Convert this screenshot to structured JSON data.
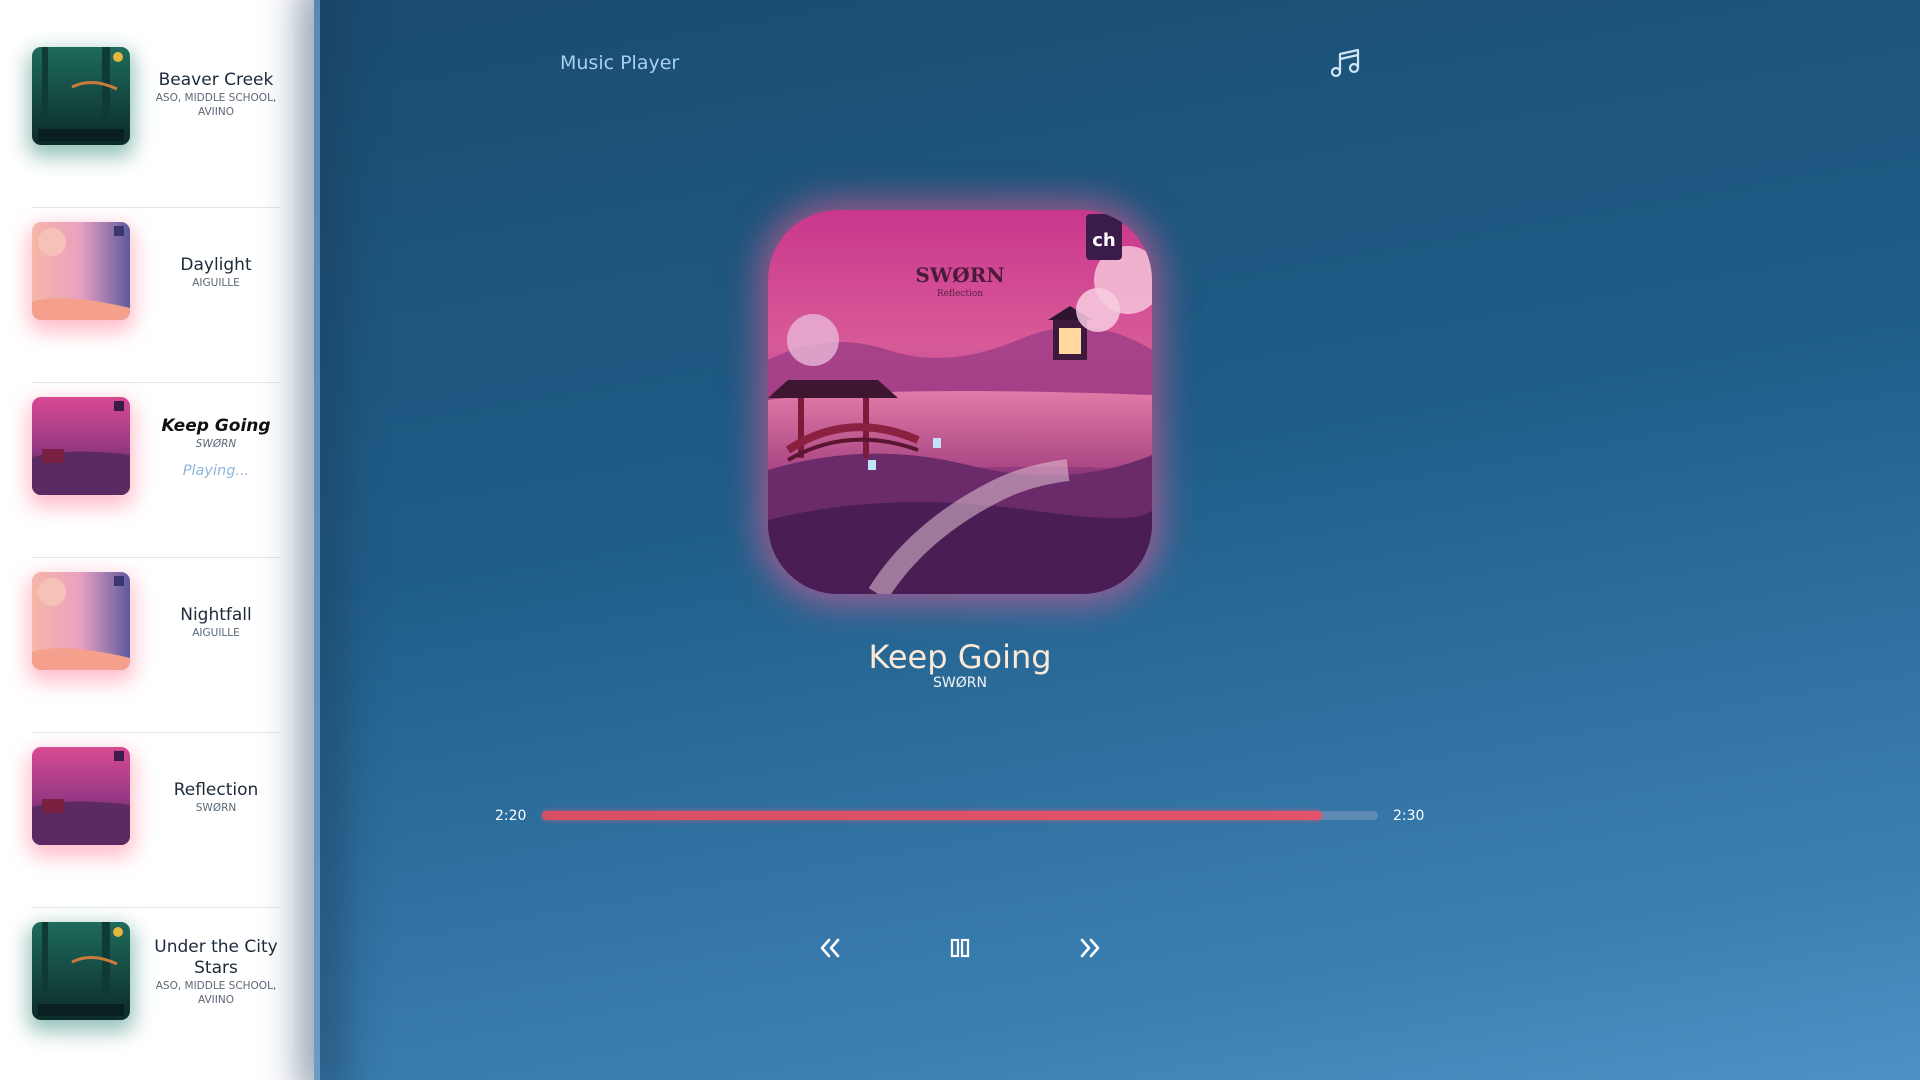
{
  "app": {
    "title": "Music Player",
    "icon": "music-note-icon"
  },
  "colors": {
    "accent_progress": "#e2526a",
    "title_text": "#fbe9d8",
    "playing_text": "#8bb6dd",
    "background_top": "#1a4a6e",
    "background_bottom": "#4d92c6"
  },
  "playlist": [
    {
      "title": "Beaver Creek",
      "artist": "ASO, MIDDLE SCHOOL, AVIINO",
      "cover": "green-forest-cover",
      "active": false
    },
    {
      "title": "Daylight",
      "artist": "AIGUILLE",
      "cover": "pink-sky-cover",
      "active": false
    },
    {
      "title": "Keep Going",
      "artist": "SWØRN",
      "cover": "magenta-garden-cover",
      "active": true,
      "status": "Playing..."
    },
    {
      "title": "Nightfall",
      "artist": "AIGUILLE",
      "cover": "pink-sky-cover",
      "active": false
    },
    {
      "title": "Reflection",
      "artist": "SWØRN",
      "cover": "magenta-garden-cover",
      "active": false
    },
    {
      "title": "Under the City Stars",
      "artist": "ASO, MIDDLE SCHOOL, AVIINO",
      "cover": "green-forest-cover",
      "active": false
    }
  ],
  "now_playing": {
    "title": "Keep Going",
    "artist": "SWØRN",
    "album_art_text": "SWØRN",
    "album_art_sub": "Reflection",
    "album_art_badge": "ch"
  },
  "progress": {
    "elapsed": "2:20",
    "total": "2:30",
    "fraction": 0.933
  },
  "controls": {
    "prev_icon": "double-chevron-left-icon",
    "pause_icon": "pause-icon",
    "next_icon": "double-chevron-right-icon"
  }
}
